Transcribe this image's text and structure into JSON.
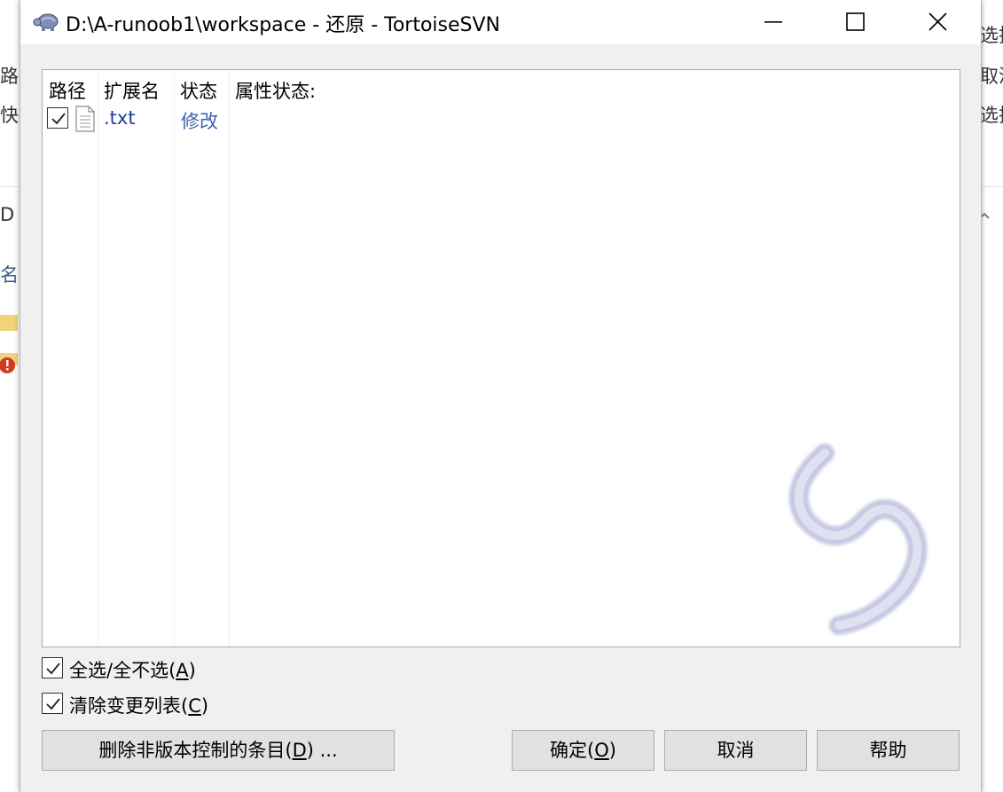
{
  "dialog": {
    "title": "D:\\A-runoob1\\workspace - 还原 - TortoiseSVN"
  },
  "background_fragments": {
    "right_1": "选择",
    "right_2": "取消",
    "right_3": "选择",
    "left_1": "路径",
    "left_2": "快捷",
    "left_3": "D",
    "left_4": "名称"
  },
  "filelist": {
    "columns": [
      "路径",
      "扩展名",
      "状态",
      "属性状态:"
    ],
    "rows": [
      {
        "path": "",
        "checked": true,
        "extension": ".txt",
        "status": "修改",
        "prop_status": ""
      }
    ]
  },
  "options": {
    "select_all_prefix": "全选/全不选(",
    "select_all_key": "A",
    "select_all_suffix": ")",
    "clear_changelist_prefix": "清除变更列表(",
    "clear_changelist_key": "C",
    "clear_changelist_suffix": ")"
  },
  "buttons": {
    "delete_unversioned_prefix": "删除非版本控制的条目(",
    "delete_unversioned_key": "D",
    "delete_unversioned_suffix": ") ...",
    "ok_prefix": "确定(",
    "ok_key": "O",
    "ok_suffix": ")",
    "cancel": "取消",
    "help": "帮助"
  },
  "colors": {
    "link_blue": "#1a3f99",
    "dialog_bg": "#f0f0f0",
    "button_bg": "#e1e1e1"
  }
}
